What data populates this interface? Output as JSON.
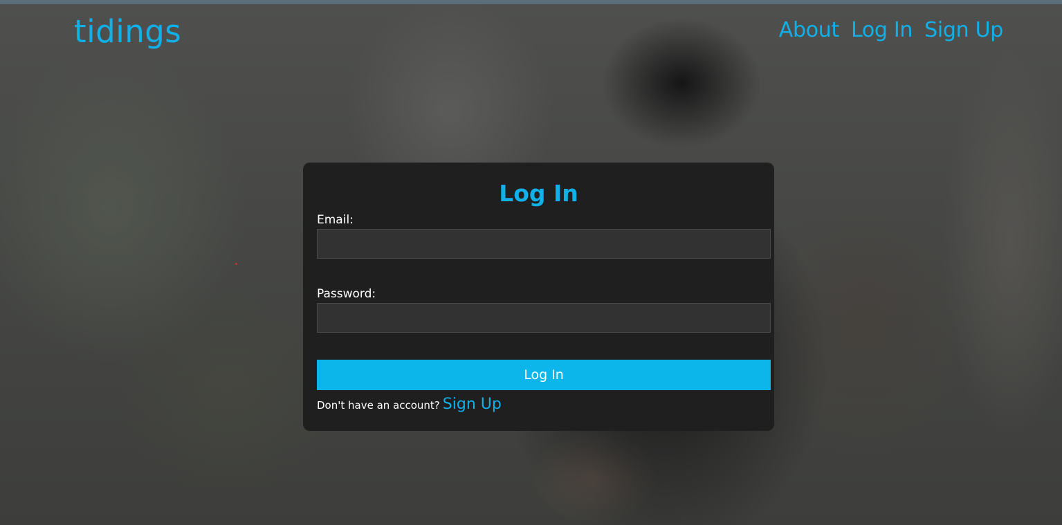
{
  "navbar": {
    "brand": "tidings",
    "links": [
      {
        "label": "About"
      },
      {
        "label": "Log In"
      },
      {
        "label": "Sign Up"
      }
    ]
  },
  "login_card": {
    "title": "Log In",
    "email_label": "Email:",
    "email_value": "",
    "password_label": "Password:",
    "password_value": "",
    "submit_label": "Log In",
    "footer_text": "Don't have an account?",
    "footer_link": "Sign Up"
  },
  "colors": {
    "accent": "#12b0e8",
    "button": "#0db6ea",
    "card_bg": "#1f1f1f",
    "input_bg": "#323232"
  }
}
